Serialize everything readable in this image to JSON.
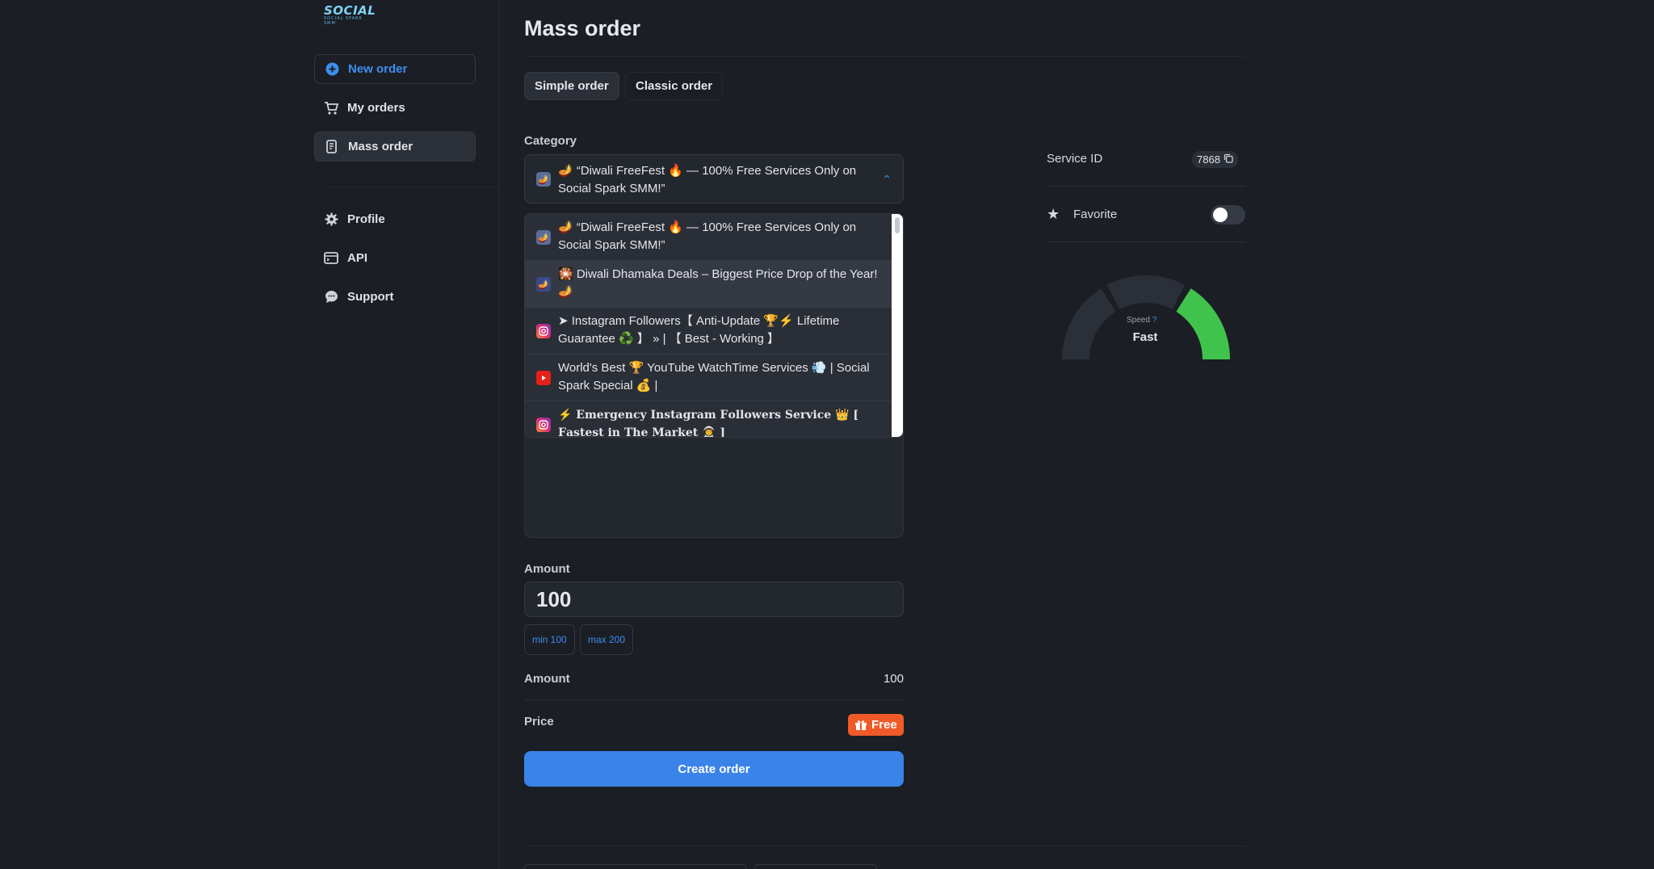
{
  "logo": {
    "text": "SOCIAL",
    "sub": "SOCIAL SPARK SMM"
  },
  "sidebar": {
    "items": [
      {
        "label": "New order"
      },
      {
        "label": "My orders"
      },
      {
        "label": "Mass order"
      },
      {
        "label": "Profile"
      },
      {
        "label": "API"
      },
      {
        "label": "Support"
      }
    ]
  },
  "main": {
    "title": "Mass order",
    "tabs": [
      {
        "label": "Simple order"
      },
      {
        "label": "Classic order"
      }
    ],
    "category_label": "Category",
    "selected_category": "🪔 “Diwali FreeFest 🔥 — 100% Free Services Only on Social Spark SMM!”",
    "dropdown_items": [
      {
        "label": "🪔 “Diwali FreeFest 🔥 — 100% Free Services Only on Social Spark SMM!”",
        "icon": "diwali-icon"
      },
      {
        "label": "🎇 Diwali Dhamaka Deals – Biggest Price Drop of the Year! 🪔",
        "icon": "diwali-icon"
      },
      {
        "label": "➤ Instagram Followers【 Anti-Update 🏆⚡ Lifetime Guarantee ♻️ 】 » | 【 Best - Working 】",
        "icon": "instagram-icon"
      },
      {
        "label": "World's Best 🏆 YouTube WatchTime Services 💨 | Social Spark Special 💰 |",
        "icon": "youtube-icon"
      },
      {
        "label": "⚡ 𝐄𝐦𝐞𝐫𝐠𝐞𝐧𝐜𝐲 𝐈𝐧𝐬𝐭𝐚𝐠𝐫𝐚𝐦 𝐅𝐨𝐥𝐥𝐨𝐰𝐞𝐫𝐬 𝐒𝐞𝐫𝐯𝐢𝐜𝐞 👑 [ 𝐅𝐚𝐬𝐭𝐞𝐬𝐭 𝐢𝐧 𝐓𝐡𝐞 𝐌𝐚𝐫𝐤𝐞𝐭 👨‍🚀 ]",
        "icon": "instagram-icon"
      }
    ],
    "amount_label": "Amount",
    "amount_value": "100",
    "min_chip": "min 100",
    "max_chip": "max 200",
    "summary_amount_label": "Amount",
    "summary_amount_value": "100",
    "price_label": "Price",
    "price_value": "Free",
    "create_button": "Create order"
  },
  "right_panel": {
    "service_id_label": "Service ID",
    "service_id": "7868",
    "favorite_label": "Favorite",
    "favorite_on": false,
    "speed_label": "Speed",
    "speed_value": "Fast",
    "speed_level": 0.85
  },
  "colors": {
    "background": "#1b1e24",
    "accent": "#3a83e8",
    "free_badge": "#f05a28",
    "gauge_active": "#3fc34c",
    "gauge_inactive": "#2b2f37"
  }
}
